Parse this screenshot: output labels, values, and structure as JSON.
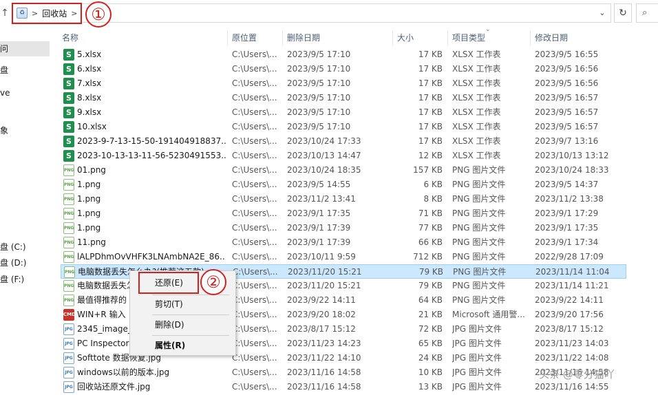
{
  "address": {
    "breadcrumb_location": "回收站",
    "separator": ">",
    "annotation_1": "①"
  },
  "nav": {
    "items": [
      {
        "label": "问",
        "selected": true
      },
      {
        "label": "盘",
        "selected": false
      },
      {
        "label": "ve",
        "selected": false
      },
      {
        "label": "象",
        "selected": false
      },
      {
        "label": "盘 (C:)",
        "selected": false
      },
      {
        "label": "盘 (D:)",
        "selected": false
      },
      {
        "label": "盘 (F:)",
        "selected": false
      }
    ]
  },
  "columns": {
    "name": "名称",
    "location": "原位置",
    "deleted": "删除日期",
    "size": "大小",
    "type": "项目类型",
    "modified": "修改日期"
  },
  "files": [
    {
      "icon": "xlsx",
      "name": "5.xlsx",
      "location": "C:\\Users\\...",
      "deleted": "2023/9/5 17:10",
      "size": "17 KB",
      "type": "XLSX 工作表",
      "modified": "2023/9/5 16:55"
    },
    {
      "icon": "xlsx",
      "name": "6.xlsx",
      "location": "C:\\Users\\...",
      "deleted": "2023/9/5 17:10",
      "size": "17 KB",
      "type": "XLSX 工作表",
      "modified": "2023/9/5 16:56"
    },
    {
      "icon": "xlsx",
      "name": "7.xlsx",
      "location": "C:\\Users\\...",
      "deleted": "2023/9/5 17:10",
      "size": "17 KB",
      "type": "XLSX 工作表",
      "modified": "2023/9/5 16:56"
    },
    {
      "icon": "xlsx",
      "name": "8.xlsx",
      "location": "C:\\Users\\...",
      "deleted": "2023/9/5 17:10",
      "size": "17 KB",
      "type": "XLSX 工作表",
      "modified": "2023/9/5 16:57"
    },
    {
      "icon": "xlsx",
      "name": "9.xlsx",
      "location": "C:\\Users\\...",
      "deleted": "2023/9/5 17:10",
      "size": "17 KB",
      "type": "XLSX 工作表",
      "modified": "2023/9/5 16:57"
    },
    {
      "icon": "xlsx",
      "name": "10.xlsx",
      "location": "C:\\Users\\...",
      "deleted": "2023/9/5 17:10",
      "size": "17 KB",
      "type": "XLSX 工作表",
      "modified": "2023/9/5 16:57"
    },
    {
      "icon": "xlsx",
      "name": "2023-9-7-13-15-50-191404918837...",
      "location": "C:\\Users\\...",
      "deleted": "2023/10/24 17:33",
      "size": "17 KB",
      "type": "XLSX 工作表",
      "modified": "2023/9/7 13:16"
    },
    {
      "icon": "xlsx",
      "name": "2023-10-13-13-11-56-5230491553...",
      "location": "C:\\Users\\...",
      "deleted": "2023/10/13 14:47",
      "size": "12 KB",
      "type": "XLSX 工作表",
      "modified": "2023/10/13 13:12"
    },
    {
      "icon": "png",
      "name": "01.png",
      "location": "C:\\Users\\...",
      "deleted": "2023/10/24 18:35",
      "size": "157 KB",
      "type": "PNG 图片文件",
      "modified": "2023/10/24 18:33"
    },
    {
      "icon": "png",
      "name": "1.png",
      "location": "C:\\Users\\...",
      "deleted": "2023/9/5 14:55",
      "size": "6 KB",
      "type": "PNG 图片文件",
      "modified": "2023/9/5 14:37"
    },
    {
      "icon": "png",
      "name": "1.png",
      "location": "C:\\Users\\...",
      "deleted": "2023/11/2 13:41",
      "size": "8 KB",
      "type": "PNG 图片文件",
      "modified": "2023/11/2 13:38"
    },
    {
      "icon": "png",
      "name": "1.png",
      "location": "C:\\Users\\...",
      "deleted": "2023/9/1 17:35",
      "size": "71 KB",
      "type": "PNG 图片文件",
      "modified": "2023/9/1 17:29"
    },
    {
      "icon": "png",
      "name": "1.png",
      "location": "C:\\Users\\...",
      "deleted": "2023/9/1 17:39",
      "size": "77 KB",
      "type": "PNG 图片文件",
      "modified": "2023/9/1 17:35"
    },
    {
      "icon": "png",
      "name": "11.png",
      "location": "C:\\Users\\...",
      "deleted": "2023/9/1 17:39",
      "size": "66 KB",
      "type": "PNG 图片文件",
      "modified": "2023/9/1 17:34"
    },
    {
      "icon": "png",
      "name": "lALPDhmOvVHFK3LNAmbNA2E_86...",
      "location": "C:\\Users\\...",
      "deleted": "2023/10/11 9:59",
      "size": "712 KB",
      "type": "PNG 图片文件",
      "modified": "2022/9/28 17:09"
    },
    {
      "icon": "png",
      "name": "电脑数据丢失怎么办?(推荐这五款)",
      "location": "C:\\Users\\...",
      "deleted": "2023/11/20 15:21",
      "size": "79 KB",
      "type": "PNG 图片文件",
      "modified": "2023/11/14 11:04",
      "highlight": true
    },
    {
      "icon": "png",
      "name": "电脑数据丢失怎",
      "location": "C:\\Users\\...",
      "deleted": "2023/11/20 15:21",
      "size": "79 KB",
      "type": "PNG 图片文件",
      "modified": "2023/11/14 11:21"
    },
    {
      "icon": "png",
      "name": "最值得推荐的",
      "location": "C:\\Users\\...",
      "deleted": "2023/9/22 14:11",
      "size": "64 KB",
      "type": "PNG 图片文件",
      "modified": "2023/9/22 14:11"
    },
    {
      "icon": "cmd",
      "name": "WIN+R  输入",
      "location": "C:\\Users\\...",
      "deleted": "2023/9/20 18:02",
      "size": "21 KB",
      "type": "Microsoft 通用警...",
      "modified": "2023/9/20 17:56"
    },
    {
      "icon": "jpg",
      "name": "2345_image_f",
      "location": "C:\\Users\\...",
      "deleted": "2023/8/17 15:12",
      "size": "72 KB",
      "type": "JPG 图片文件",
      "modified": "2023/8/17 15:12"
    },
    {
      "icon": "jpg",
      "name": "PC Inspector",
      "location": "C:\\Users\\...",
      "deleted": "2023/11/23 14:23",
      "size": "65 KB",
      "type": "JPG 图片文件",
      "modified": "2023/11/23 14:03"
    },
    {
      "icon": "jpg",
      "name": "Softtote 数据恢复.jpg",
      "location": "C:\\Users\\...",
      "deleted": "2023/11/22 14:10",
      "size": "24 KB",
      "type": "JPG 图片文件",
      "modified": "2023/11/22 14:08"
    },
    {
      "icon": "jpg",
      "name": "windows以前的版本.jpg",
      "location": "C:\\Users\\...",
      "deleted": "2023/11/16 14:58",
      "size": "10 KB",
      "type": "JPG 图片文件",
      "modified": "2023/11/16 14:58"
    },
    {
      "icon": "jpg",
      "name": "回收站还原文件.jpg",
      "location": "C:\\Users\\...",
      "deleted": "2023/11/16 14:58",
      "size": "13 KB",
      "type": "JPG 图片文件",
      "modified": "2023/11/16 14:55"
    }
  ],
  "icon_labels": {
    "xlsx": "S",
    "png": "PNG",
    "jpg": "JPG",
    "cmd": "CMD"
  },
  "context_menu": {
    "restore": "还原(E)",
    "cut": "剪切(T)",
    "delete": "删除(D)",
    "properties": "属性(R)",
    "annotation_2": "②"
  },
  "watermark": "头条 @零分猫吖"
}
